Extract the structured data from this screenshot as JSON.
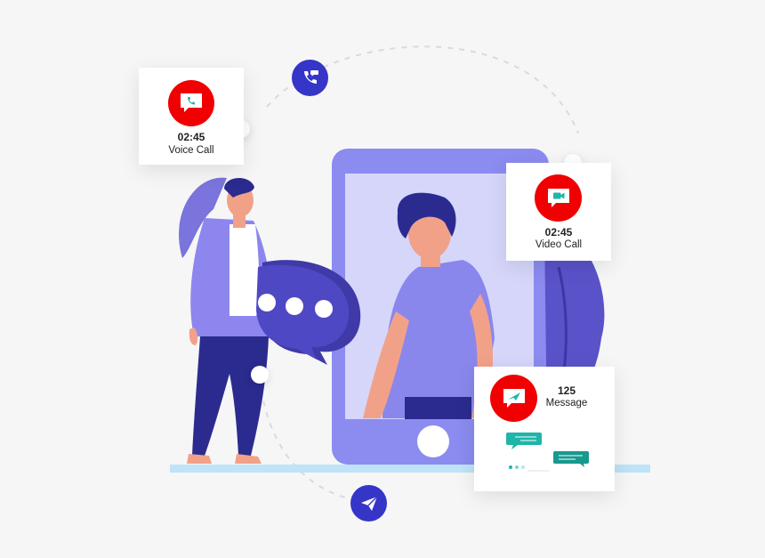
{
  "voice_call": {
    "time": "02:45",
    "label": "Voice Call",
    "icon": "phone-chat-icon"
  },
  "video_call": {
    "time": "02:45",
    "label": "Video Call",
    "icon": "video-chat-icon"
  },
  "message": {
    "count": "125",
    "label": "Message",
    "icon": "send-chat-icon"
  },
  "floating_icons": {
    "top": "phone-transfer-icon",
    "bottom": "paper-plane-icon"
  },
  "colors": {
    "badge_red": "#f00000",
    "accent_blue": "#3535c8",
    "phone_purple": "#8a8af0",
    "teal": "#1fb5a8",
    "background": "#f6f6f7"
  }
}
